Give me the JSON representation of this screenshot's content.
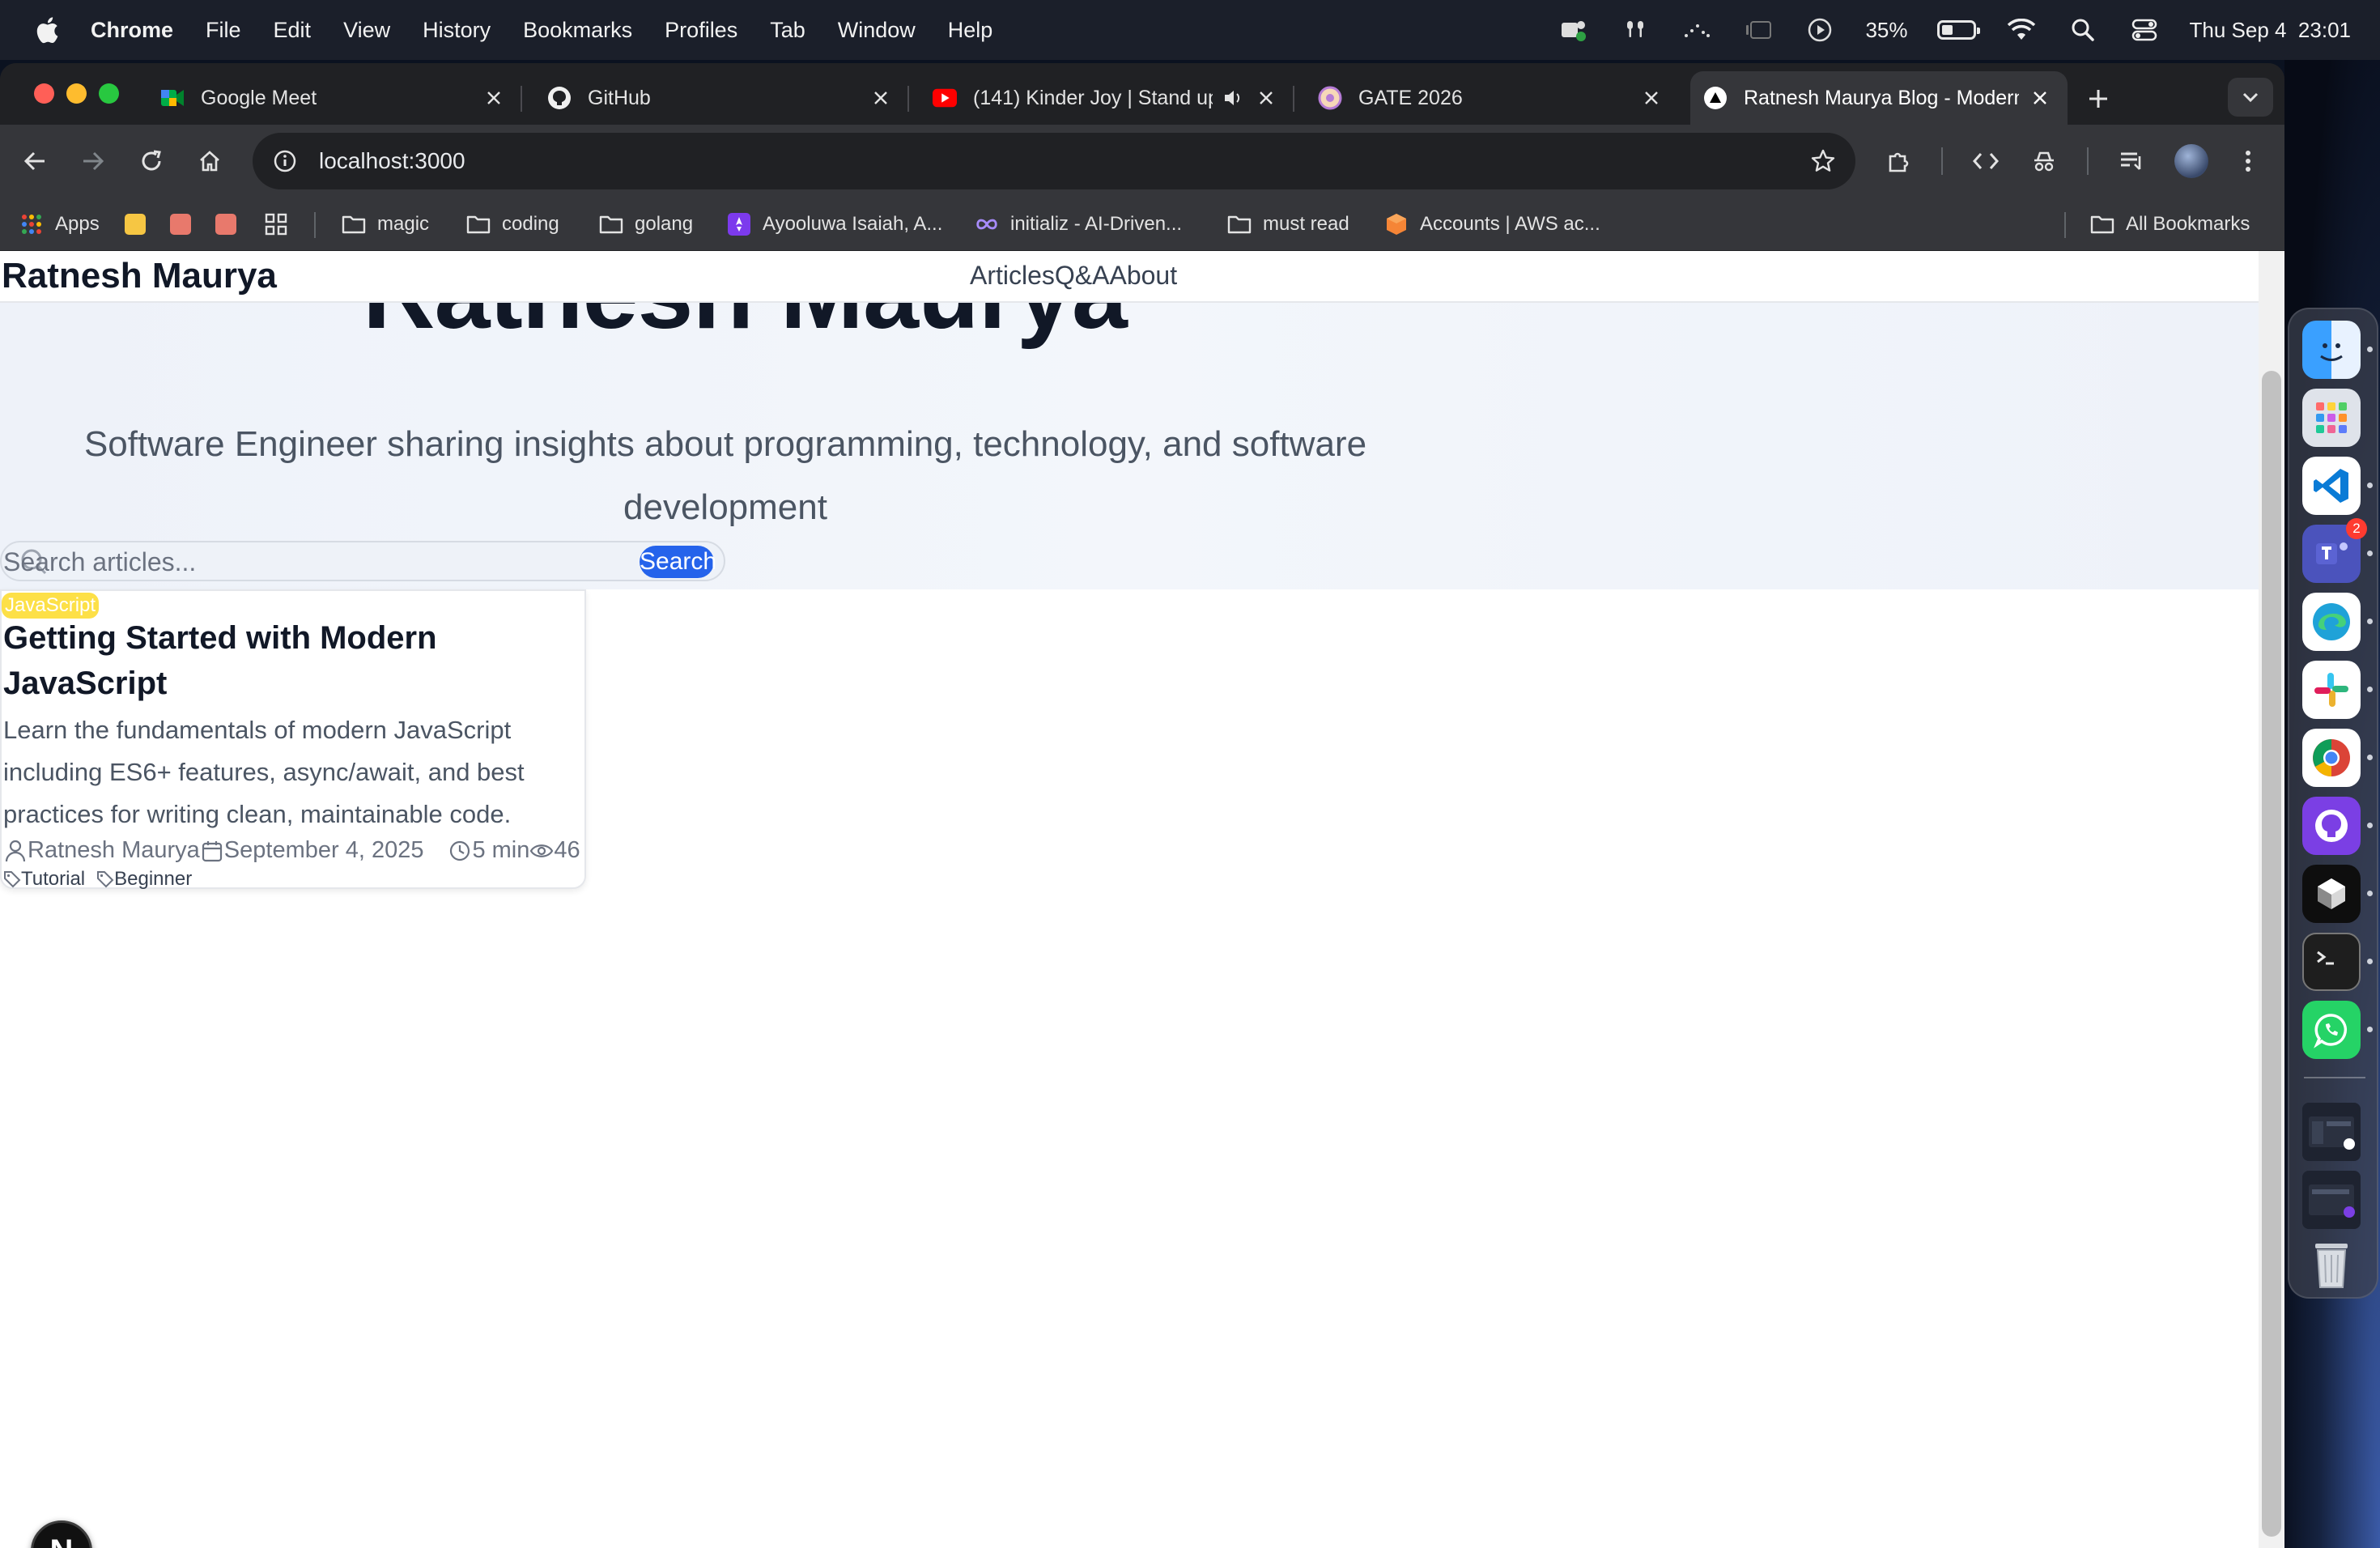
{
  "menubar": {
    "items": [
      "Chrome",
      "File",
      "Edit",
      "View",
      "History",
      "Bookmarks",
      "Profiles",
      "Tab",
      "Window",
      "Help"
    ],
    "battery_percent": "35%",
    "battery_level": 0.35,
    "datetime": "Thu Sep 4  23:01"
  },
  "tabs": [
    {
      "title": "Google Meet",
      "icon": "google-meet-icon"
    },
    {
      "title": "GitHub",
      "icon": "github-icon"
    },
    {
      "title": "(141) Kinder Joy | Stand up",
      "icon": "youtube-icon",
      "audio": true
    },
    {
      "title": "GATE 2026",
      "icon": "gate-icon"
    },
    {
      "title": "Ratnesh Maurya Blog - Modern",
      "icon": "site-triangle-icon",
      "active": true
    }
  ],
  "omnibox": {
    "url": "localhost:3000"
  },
  "bookmarks": {
    "apps": "Apps",
    "items": [
      "magic",
      "coding",
      "golang",
      "Ayooluwa Isaiah, A...",
      "initializ - AI-Driven...",
      "must read",
      "Accounts | AWS ac..."
    ],
    "all": "All Bookmarks"
  },
  "site": {
    "brand": "Ratnesh Maurya",
    "nav": [
      "Articles",
      "Q&A",
      "About"
    ],
    "hero_title": "Ratnesh Maurya",
    "subtitle": "Software Engineer sharing insights about programming, technology, and software development",
    "search_placeholder": "Search articles...",
    "search_button": "Search"
  },
  "article": {
    "category": "JavaScript",
    "title": "Getting Started with Modern JavaScript",
    "excerpt": "Learn the fundamentals of modern JavaScript including ES6+ features, async/await, and best practices for writing clean, maintainable code.",
    "author": "Ratnesh Maurya",
    "date": "September 4, 2025",
    "read_time": "5 min",
    "views": "46",
    "tags": [
      "Tutorial",
      "Beginner"
    ]
  },
  "dev_badge": "N",
  "dock": {
    "apps": [
      "finder-icon",
      "launchpad-icon",
      "vscode-icon",
      "teams-icon",
      "edge-icon",
      "slack-icon",
      "chrome-icon",
      "github-desktop-icon",
      "cursor-icon",
      "terminal-icon",
      "whatsapp-icon"
    ],
    "teams_badge": "2"
  },
  "colors": {
    "accent": "#2563eb",
    "category_badge": "#fde047",
    "chrome_dark": "#202124",
    "chrome_toolbar": "#35363a"
  }
}
